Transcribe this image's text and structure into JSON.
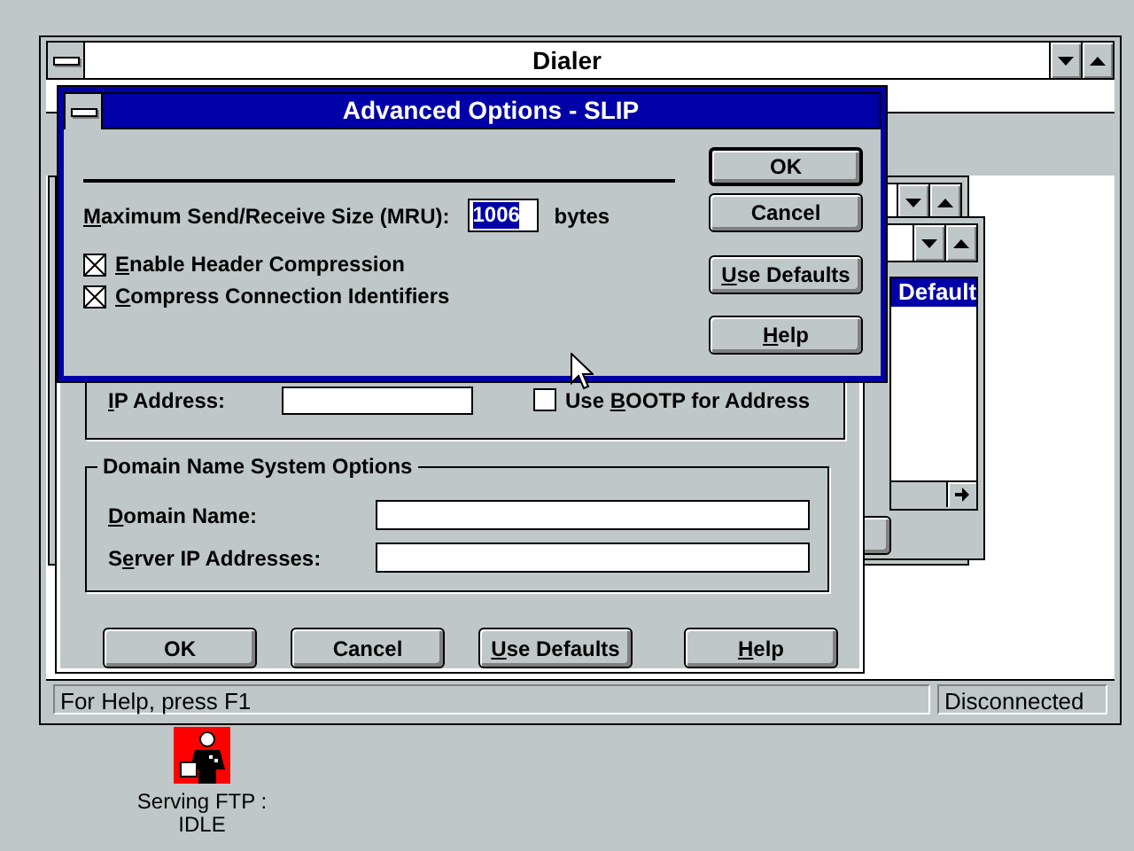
{
  "dialer": {
    "title": "Dialer",
    "status_text": "For Help, press F1",
    "connection_status": "Disconnected"
  },
  "profile_list": {
    "items": [
      {
        "label": "Default",
        "selected": true
      }
    ]
  },
  "setup_dialog": {
    "ip_address_label": {
      "key": "I",
      "post": "P Address:"
    },
    "bootp": {
      "label": {
        "pre": "Use ",
        "key": "B",
        "post": "OOTP for Address"
      },
      "checked": false
    },
    "dns_group": "Domain Name System Options",
    "fields": [
      {
        "label": {
          "key": "D",
          "post": "omain Name:"
        }
      },
      {
        "label": {
          "pre": "S",
          "key": "e",
          "post": "rver IP Addresses:"
        }
      }
    ],
    "buttons": [
      {
        "label": {
          "pre": "OK"
        },
        "default": false
      },
      {
        "label": {
          "pre": "Cancel"
        },
        "default": false
      },
      {
        "label": {
          "key": "U",
          "post": "se Defaults"
        },
        "default": false
      },
      {
        "label": {
          "key": "H",
          "post": "elp"
        },
        "default": false
      }
    ]
  },
  "advanced_dialog": {
    "title": "Advanced Options - SLIP",
    "mru_label": {
      "key": "M",
      "post": "aximum Send/Receive Size (MRU):"
    },
    "mru_value": "1006",
    "mru_unit": "bytes",
    "checkboxes": [
      {
        "label": {
          "key": "E",
          "post": "nable Header Compression"
        },
        "checked": true
      },
      {
        "label": {
          "key": "C",
          "post": "ompress Connection Identifiers"
        },
        "checked": true
      }
    ],
    "buttons": [
      {
        "label": {
          "pre": "OK"
        },
        "default": true
      },
      {
        "label": {
          "pre": "Cancel"
        },
        "default": false
      },
      {
        "label": {
          "key": "U",
          "post": "se Defaults"
        },
        "default": false
      },
      {
        "label": {
          "key": "H",
          "post": "elp"
        },
        "default": false
      }
    ]
  },
  "desktop_icons": [
    {
      "label_lines": [
        "Serving FTP :",
        "IDLE"
      ]
    }
  ]
}
